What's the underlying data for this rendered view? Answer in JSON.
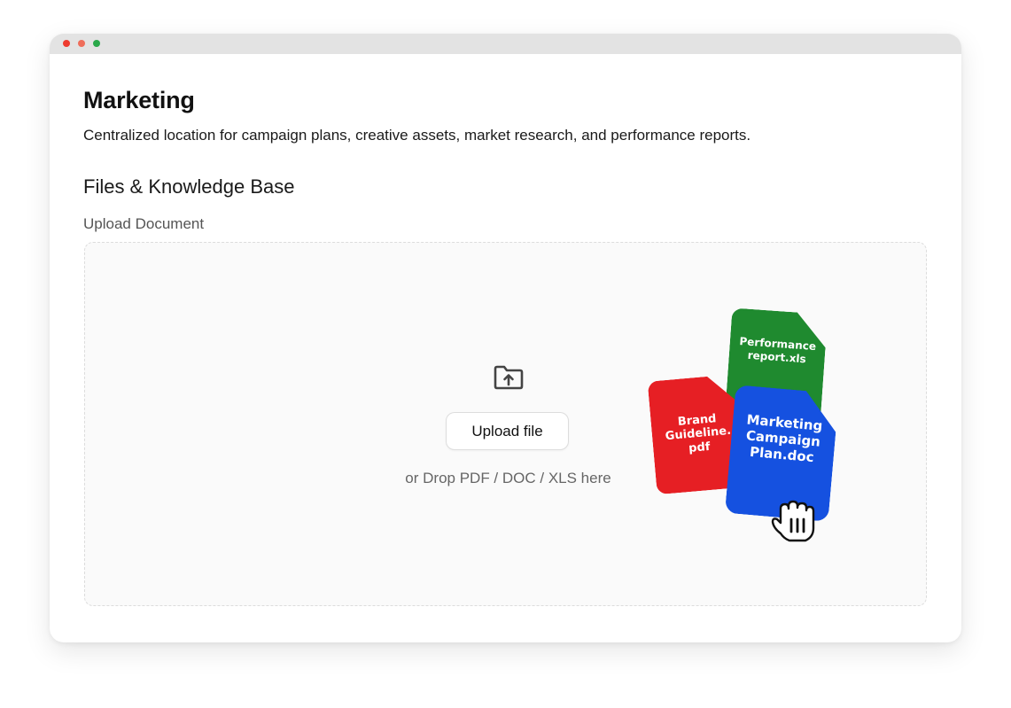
{
  "window": {
    "controls": [
      "close",
      "minimize",
      "maximize"
    ]
  },
  "page": {
    "title": "Marketing",
    "description": "Centralized location for campaign plans, creative assets, market research, and performance reports."
  },
  "files_section": {
    "title": "Files & Knowledge Base",
    "upload_label": "Upload Document",
    "dropzone": {
      "icon": "folder-upload-icon",
      "button_label": "Upload file",
      "hint": "or Drop PDF / DOC / XLS here"
    },
    "illustration": {
      "cards": [
        {
          "name": "Performance report.xls",
          "color": "#1f8a2f"
        },
        {
          "name": "Brand Guideline. pdf",
          "color": "#e61f24"
        },
        {
          "name": "Marketing Campaign Plan.doc",
          "color": "#1551e0"
        }
      ],
      "cursor_icon": "grab-hand-icon"
    }
  }
}
